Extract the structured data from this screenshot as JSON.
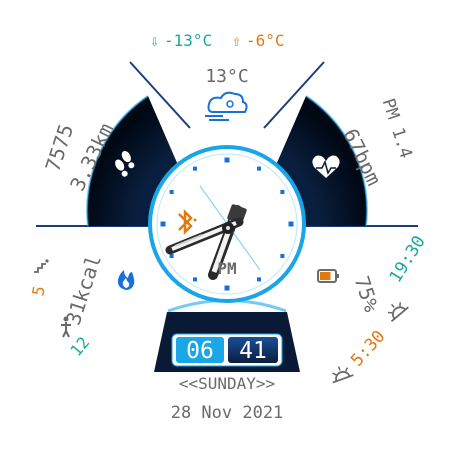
{
  "weather": {
    "min_temp": "-13°C",
    "max_temp": "-6°C",
    "current_temp": "13°C",
    "icon": "cloud-wind-icon"
  },
  "steps": {
    "count": "7575",
    "distance": "3.33km",
    "icon": "footprints-icon"
  },
  "heart": {
    "pm": "PM 1.4",
    "bpm": "67bpm",
    "icon": "heart-pulse-icon"
  },
  "calories": {
    "value": "31kcal",
    "icon": "fire-icon"
  },
  "floors": {
    "value": "5",
    "icon": "stairs-icon"
  },
  "stand": {
    "value": "12",
    "icon": "standing-person-icon"
  },
  "battery": {
    "percent": "75%",
    "level": 0.75,
    "icon": "battery-icon"
  },
  "sun": {
    "sunset": "19:30",
    "sunrise": "5:30",
    "sunset_icon": "sunset-icon",
    "sunrise_icon": "sunrise-icon"
  },
  "analog": {
    "ampm": "PM",
    "bluetooth_icon": "bluetooth-icon"
  },
  "digital": {
    "hours": "06",
    "minutes": "41"
  },
  "date": {
    "weekday": "<<SUNDAY>>",
    "full": "28 Nov 2021"
  },
  "colors": {
    "accent_blue": "#1aa7e8",
    "orange": "#e07b12",
    "teal": "#17a99a",
    "dark_navy": "#0b1a33",
    "gray": "#6a6a6a"
  }
}
